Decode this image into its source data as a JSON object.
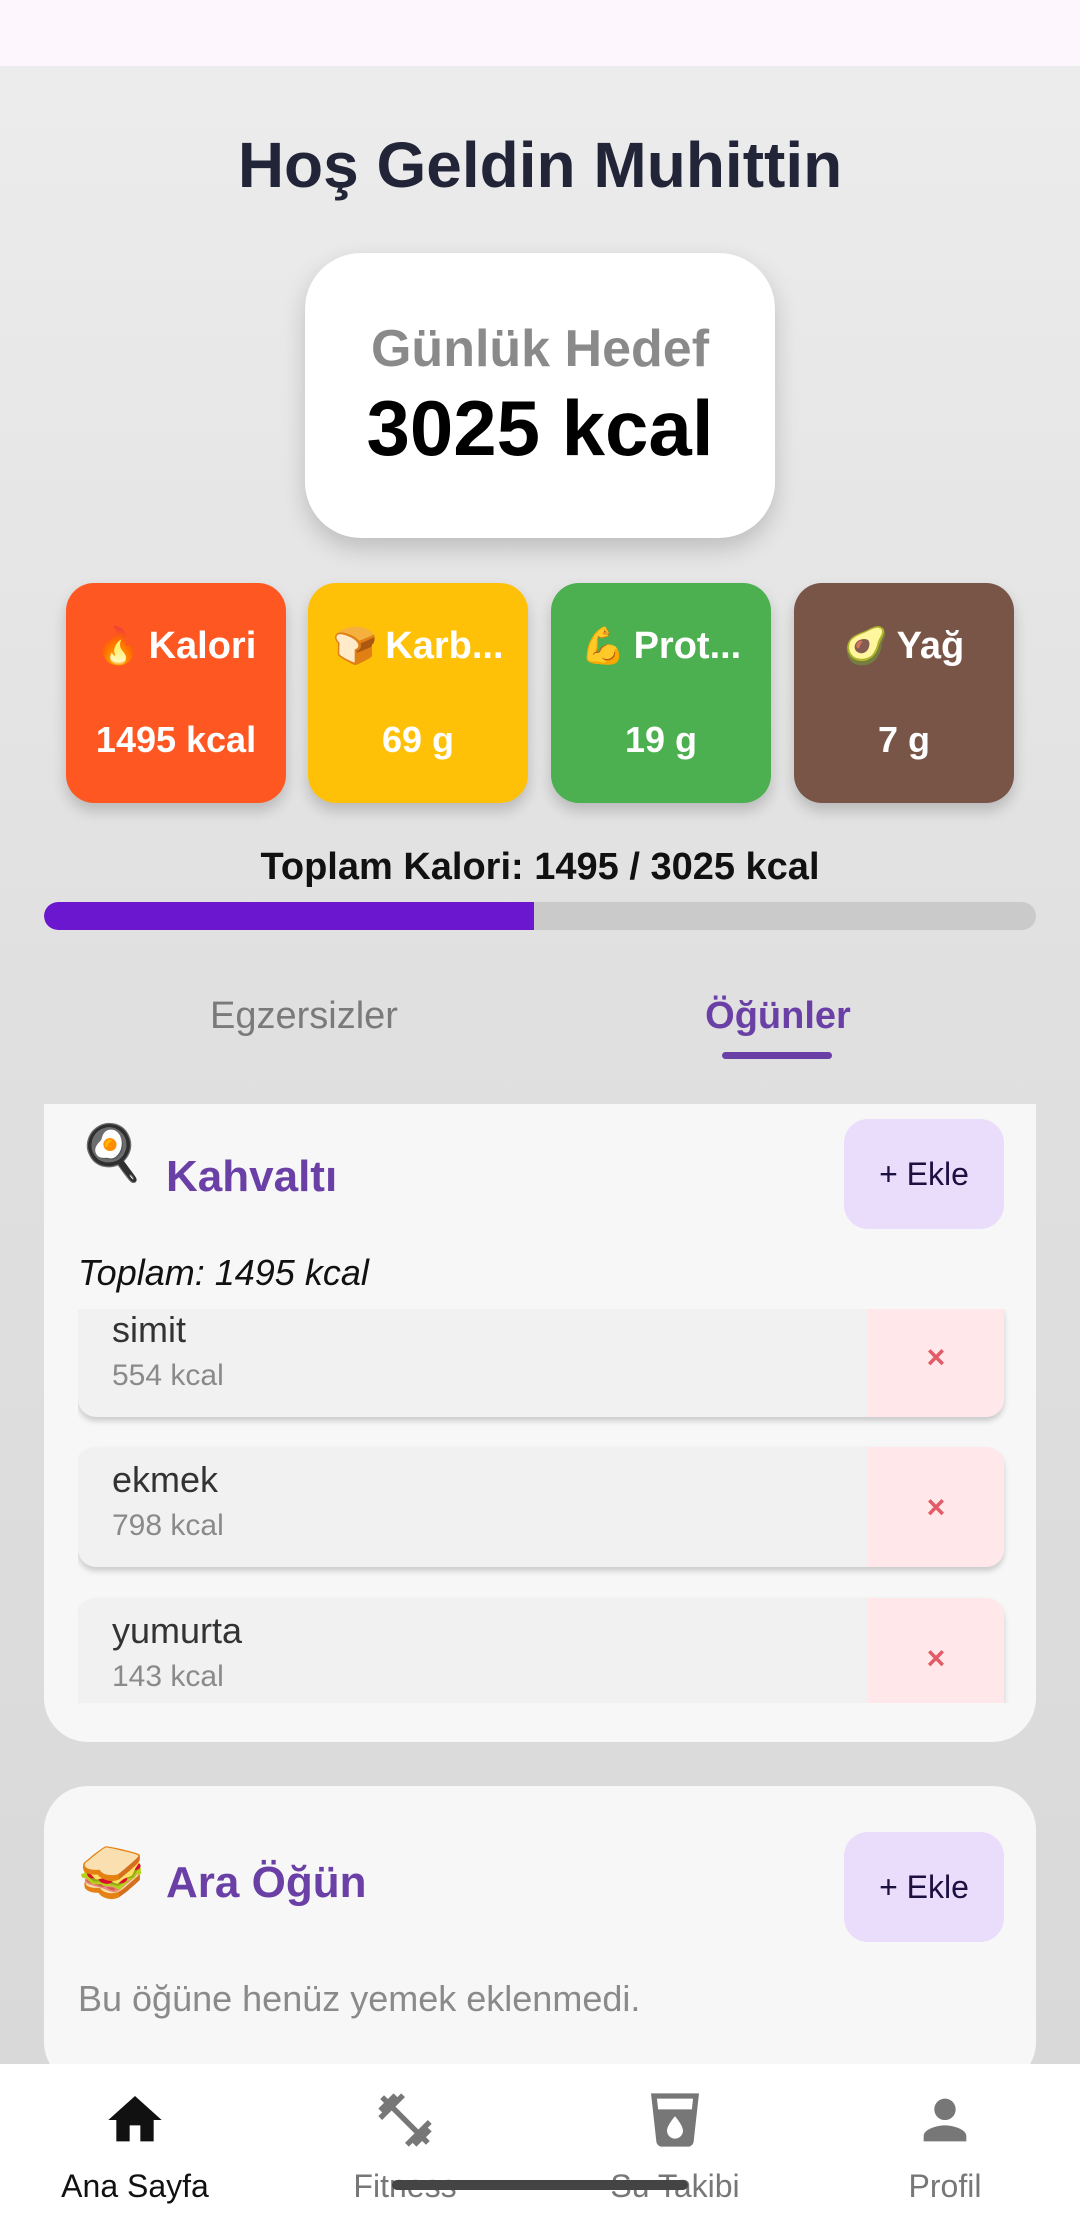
{
  "header": {
    "title": "Hoş Geldin Muhittin"
  },
  "goal": {
    "label": "Günlük Hedef",
    "value": "3025 kcal"
  },
  "macros": [
    {
      "emoji": "🔥",
      "label": "Kalori",
      "value": "1495 kcal",
      "color": "#ff5722"
    },
    {
      "emoji": "🍞",
      "label": "Karb...",
      "value": "69 g",
      "color": "#ffc107"
    },
    {
      "emoji": "💪",
      "label": "Prot...",
      "value": "19 g",
      "color": "#4caf50"
    },
    {
      "emoji": "🥑",
      "label": "Yağ",
      "value": "7 g",
      "color": "#795548"
    }
  ],
  "total": {
    "text": "Toplam Kalori: 1495 / 3025 kcal",
    "progress_fraction": 0.494
  },
  "tabs": [
    {
      "label": "Egzersizler",
      "active": false
    },
    {
      "label": "Öğünler",
      "active": true
    }
  ],
  "meals": [
    {
      "icon": "🍳",
      "title": "Kahvaltı",
      "add_label": "+ Ekle",
      "total": "Toplam: 1495 kcal",
      "items": [
        {
          "name": "simit",
          "kcal": "554 kcal",
          "delete_label": "×"
        },
        {
          "name": "ekmek",
          "kcal": "798 kcal",
          "delete_label": "×"
        },
        {
          "name": "yumurta",
          "kcal": "143 kcal",
          "delete_label": "×"
        }
      ]
    },
    {
      "icon": "🥪",
      "title": "Ara Öğün",
      "add_label": "+ Ekle",
      "empty_text": "Bu öğüne henüz yemek eklenmedi."
    }
  ],
  "nav": [
    {
      "label": "Ana Sayfa",
      "icon": "home-icon",
      "active": true
    },
    {
      "label": "Fitness",
      "icon": "dumbbell-icon",
      "active": false
    },
    {
      "label": "Su Takibi",
      "icon": "water-glass-icon",
      "active": false
    },
    {
      "label": "Profil",
      "icon": "person-icon",
      "active": false
    }
  ],
  "colors": {
    "accent": "#6a3fa6",
    "progress": "#6b17cf"
  }
}
